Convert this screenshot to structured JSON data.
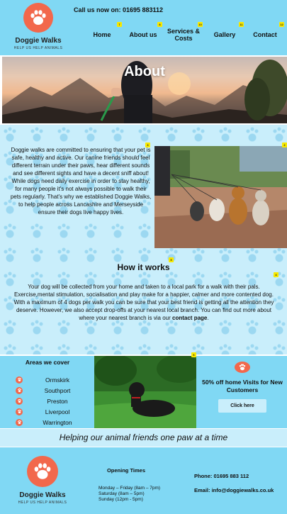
{
  "brand": {
    "name": "Doggie Walks",
    "tagline": "HELP US HELP ANIMALS",
    "accent_color": "#f2684c",
    "primary_bg": "#80d8f4",
    "light_bg": "#c9eefb"
  },
  "header": {
    "phone": "Call us now on: 01695 883112",
    "nav": [
      {
        "label": "Home",
        "mark": "7"
      },
      {
        "label": "About us",
        "mark": "8"
      },
      {
        "label": "Services & Costs",
        "mark": "10"
      },
      {
        "label": "Gallery",
        "mark": "11"
      },
      {
        "label": "Contact",
        "mark": "12"
      }
    ]
  },
  "hero": {
    "title": "About"
  },
  "marks": {
    "intro": "3",
    "photo": "2",
    "how": "5",
    "howtext": "4",
    "areas_photo": "6"
  },
  "about": {
    "intro": "Doggie walks are committed to ensuring that your pet is safe, healthy and active. Our canine friends should feel different terrain under their paws, hear different sounds and see different sights and have a decent sniff about! While dogs need daily exercise in order to stay healthy, for many people it's not always possible to walk their pets regularly. That's why we established Doggie Walks, to help people across Lancashire and Merseyside ensure their dogs live happy lives.",
    "how_title": "How it works",
    "how_text": "Your dog will be collected from your home and taken to a local park for a walk with their pals. Exercise,mental stimulation, socialisation and play make for a happier, calmer and more contented dog. With a maximum of 4 dogs per walk you can be sure that your best friend is getting all the attention they deserve. However, we also accept drop-offs at your nearest local branch. You can find out more about where your nearest branch is via our ",
    "how_link": "contact page",
    "how_end": "."
  },
  "areas": {
    "title": "Areas we cover",
    "items": [
      "Ormskirk",
      "Southport",
      "Preston",
      "Liverpool",
      "Warrington"
    ]
  },
  "offer": {
    "text": "50% off home Visits for New Customers",
    "button": "Click here"
  },
  "tagline": "Helping our animal friends one paw at a time",
  "footer": {
    "hours_title": "Opening Times",
    "hours": [
      "Monday – Friday (8am – 7pm)",
      "Saturday (8am – 5pm)",
      "Sunday (12pm - 5pm)"
    ],
    "phone": "Phone: 01695 883 112",
    "email": "Email: info@doggiewalks.co.uk"
  }
}
